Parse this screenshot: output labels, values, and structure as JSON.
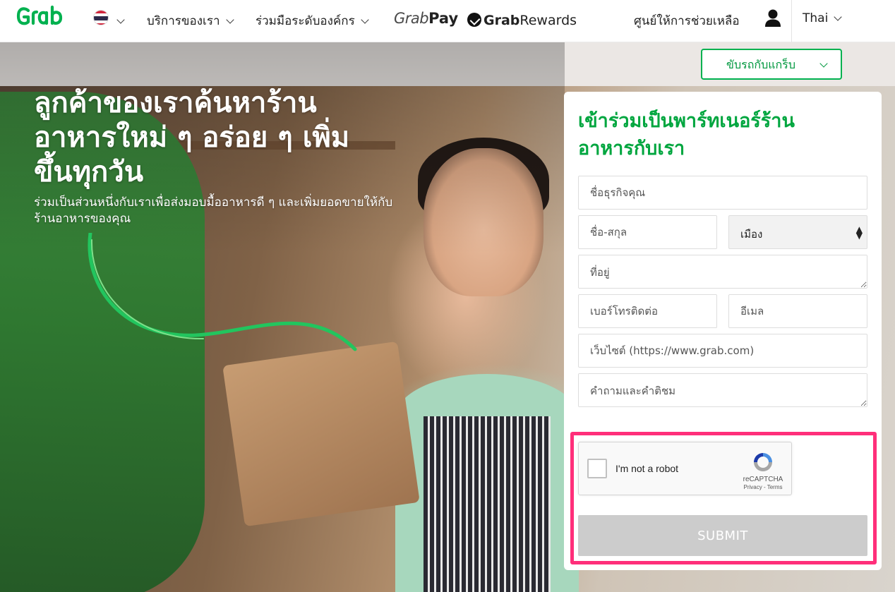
{
  "brand": {
    "logo_text": "Grab",
    "accent": "#00b14f",
    "form_title_color": "#00a63f",
    "highlight_color": "#ff2f7a"
  },
  "nav": {
    "flag_icon": "thailand-flag-icon",
    "services": "บริการของเรา",
    "partner": "ร่วมมือระดับองค์กร",
    "grabpay": {
      "g": "Grab",
      "rest": "Pay"
    },
    "rewards": {
      "bold": "Grab",
      "rest": "Rewards"
    },
    "help": "ศูนย์ให้การช่วยเหลือ",
    "user_icon": "user-icon",
    "language": "Thai"
  },
  "drive_dropdown": "ขับรถกับแกร็บ",
  "hero": {
    "title_lines": [
      "ลูกค้าของเราค้นหาร้าน",
      "อาหารใหม่ ๆ อร่อย ๆ เพิ่ม",
      "ขึ้นทุกวัน"
    ],
    "subtitle_lines": [
      "ร่วมเป็นส่วนหนึ่งกับเราเพื่อส่งมอบมื้ออาหารดี ๆ และเพิ่มยอดขายให้กับ",
      "ร้านอาหารของคุณ"
    ]
  },
  "form": {
    "title_lines": [
      "เข้าร่วมเป็นพาร์ทเนอร์ร้าน",
      "อาหารกับเรา"
    ],
    "business_name_placeholder": "ชื่อธุรกิจคุณ",
    "full_name_placeholder": "ชื่อ-สกุล",
    "city_selected": "เมือง",
    "address_placeholder": "ที่อยู่",
    "phone_placeholder": "เบอร์โทรติดต่อ",
    "email_placeholder": "อีเมล",
    "website_placeholder": "เว็บไซต์ (https://www.grab.com)",
    "questions_placeholder": "คำถามและคำติชม",
    "recaptcha": {
      "label": "I'm not a robot",
      "brand": "reCAPTCHA",
      "links": "Privacy - Terms",
      "checked": false
    },
    "submit_label": "SUBMIT",
    "submit_enabled": false
  }
}
